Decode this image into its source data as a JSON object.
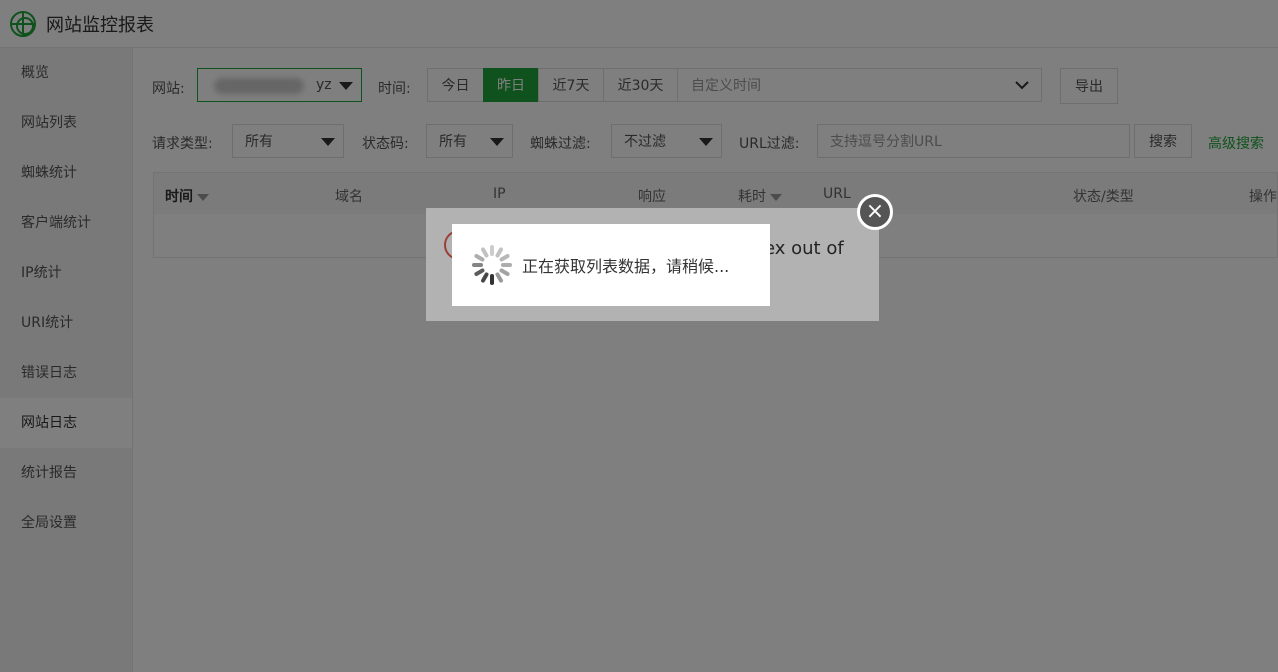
{
  "app": {
    "title": "网站监控报表"
  },
  "sidebar": {
    "items": [
      {
        "label": "概览"
      },
      {
        "label": "网站列表"
      },
      {
        "label": "蜘蛛统计"
      },
      {
        "label": "客户端统计"
      },
      {
        "label": "IP统计"
      },
      {
        "label": "URI统计"
      },
      {
        "label": "错误日志"
      },
      {
        "label": "网站日志",
        "active": true
      },
      {
        "label": "统计报告"
      },
      {
        "label": "全局设置"
      }
    ]
  },
  "filters": {
    "site_label": "网站:",
    "site_value_suffix": "yz",
    "time_label": "时间:",
    "time_options": [
      "今日",
      "昨日",
      "近7天",
      "近30天"
    ],
    "time_selected": "昨日",
    "custom_time_placeholder": "自定义时间",
    "export_label": "导出",
    "request_type_label": "请求类型:",
    "request_type_value": "所有",
    "status_code_label": "状态码:",
    "status_code_value": "所有",
    "spider_filter_label": "蜘蛛过滤:",
    "spider_filter_value": "不过滤",
    "url_filter_label": "URL过滤:",
    "url_filter_placeholder": "支持逗号分割URL",
    "search_label": "搜索",
    "advanced_search_label": "高级搜索"
  },
  "table": {
    "headers": [
      "时间",
      "域名",
      "IP",
      "响应",
      "耗时",
      "URL",
      "状态/类型",
      "操作"
    ]
  },
  "dialog": {
    "error_text": "ex out of",
    "close_icon": "×",
    "loading_text": "正在获取列表数据，请稍候..."
  },
  "colors": {
    "accent": "#20a53a",
    "error": "#e05a4e"
  }
}
